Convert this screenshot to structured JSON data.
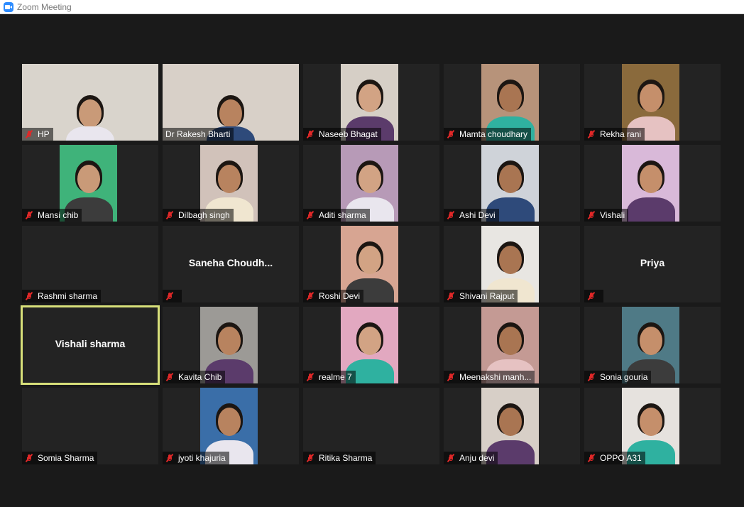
{
  "window": {
    "title": "Zoom Meeting",
    "icon": "zoom-app-icon"
  },
  "active_speaker": "Vishali sharma",
  "colors": {
    "background": "#1a1a1a",
    "tile": "#232323",
    "active_border": "#d8e07a",
    "muted_mic": "#e02828"
  },
  "participants": [
    {
      "name": "HP",
      "muted": true,
      "video": "full",
      "bg": "#d9d4cc"
    },
    {
      "name": "Dr Rakesh Bharti",
      "muted": false,
      "video": "full",
      "bg": "#d8d0c8"
    },
    {
      "name": "Naseeb Bhagat",
      "muted": true,
      "video": "portrait",
      "bg": "#d6cfc6"
    },
    {
      "name": "Mamta choudhary",
      "muted": true,
      "video": "portrait",
      "bg": "#b7937a"
    },
    {
      "name": "Rekha rani",
      "muted": true,
      "video": "portrait",
      "bg": "#8a6a3c"
    },
    {
      "name": "Mansi chib",
      "muted": true,
      "video": "portrait",
      "bg": "#3fb37a"
    },
    {
      "name": "Dilbagh singh",
      "muted": true,
      "video": "portrait",
      "bg": "#d1c2ba"
    },
    {
      "name": "Aditi sharma",
      "muted": true,
      "video": "portrait",
      "bg": "#b79ab7"
    },
    {
      "name": "Ashi Devi",
      "muted": true,
      "video": "portrait",
      "bg": "#cfd3d9"
    },
    {
      "name": "Vishali",
      "muted": true,
      "video": "portrait",
      "bg": "#d9b9d9"
    },
    {
      "name": "Rashmi sharma",
      "muted": true,
      "video": "none"
    },
    {
      "name": "",
      "display_name": "Saneha  Choudh...",
      "muted": true,
      "video": "none"
    },
    {
      "name": "Roshi Devi",
      "muted": true,
      "video": "portrait",
      "bg": "#d7a592"
    },
    {
      "name": "Shivani Rajput",
      "muted": true,
      "video": "portrait",
      "bg": "#e8e6e2"
    },
    {
      "name": "",
      "display_name": "Priya",
      "muted": true,
      "video": "none"
    },
    {
      "name": "",
      "display_name": "Vishali sharma",
      "muted": false,
      "video": "none",
      "active": true
    },
    {
      "name": "Kavita Chib",
      "muted": true,
      "video": "portrait",
      "bg": "#9c9a96"
    },
    {
      "name": "realme 7",
      "muted": true,
      "video": "portrait",
      "bg": "#e2a8c0"
    },
    {
      "name": "Meenakshi manh...",
      "muted": true,
      "video": "portrait",
      "bg": "#c49a94"
    },
    {
      "name": "Sonia gouria",
      "muted": true,
      "video": "portrait",
      "bg": "#4f7a86"
    },
    {
      "name": "Somia Sharma",
      "muted": true,
      "video": "none"
    },
    {
      "name": "jyoti khajuria",
      "muted": true,
      "video": "portrait",
      "bg": "#3a6ea8"
    },
    {
      "name": "Ritika Sharma",
      "muted": true,
      "video": "none"
    },
    {
      "name": "Anju devi",
      "muted": true,
      "video": "portrait",
      "bg": "#d7cfc7"
    },
    {
      "name": "OPPO A31",
      "muted": true,
      "video": "portrait",
      "bg": "#e6e2de"
    }
  ]
}
